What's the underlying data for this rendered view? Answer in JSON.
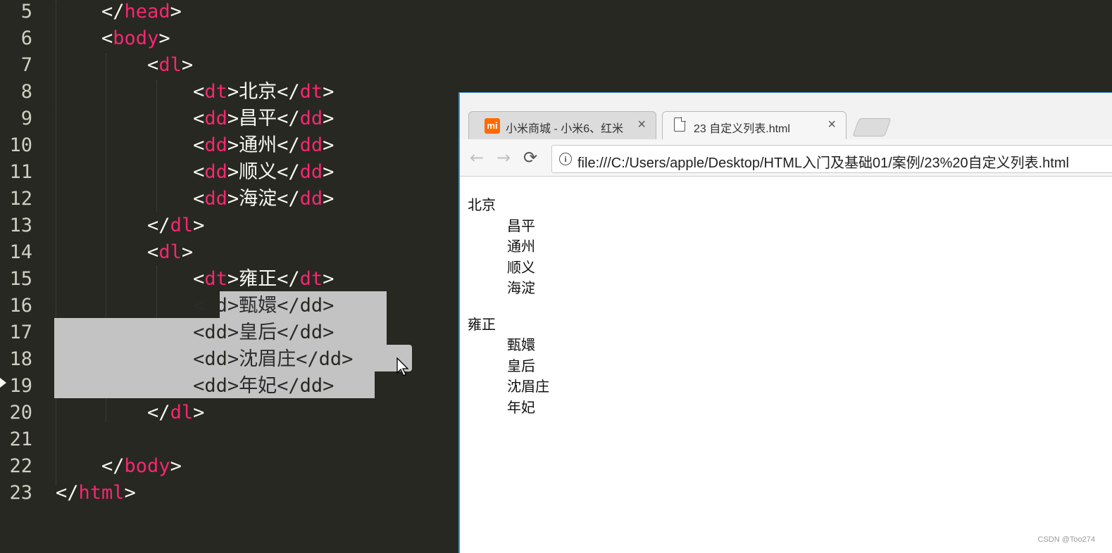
{
  "editor": {
    "lines": [
      {
        "num": "5",
        "indent": "    ",
        "open": "</",
        "tag": "head",
        "close": ">",
        "text": "",
        "etag": ""
      },
      {
        "num": "6",
        "indent": "    ",
        "open": "<",
        "tag": "body",
        "close": ">",
        "text": "",
        "etag": ""
      },
      {
        "num": "7",
        "indent": "        ",
        "open": "<",
        "tag": "dl",
        "close": ">",
        "text": "",
        "etag": ""
      },
      {
        "num": "8",
        "indent": "            ",
        "open": "<",
        "tag": "dt",
        "close": ">",
        "text": "北京",
        "etag": "dt"
      },
      {
        "num": "9",
        "indent": "            ",
        "open": "<",
        "tag": "dd",
        "close": ">",
        "text": "昌平",
        "etag": "dd"
      },
      {
        "num": "10",
        "indent": "            ",
        "open": "<",
        "tag": "dd",
        "close": ">",
        "text": "通州",
        "etag": "dd"
      },
      {
        "num": "11",
        "indent": "            ",
        "open": "<",
        "tag": "dd",
        "close": ">",
        "text": "顺义",
        "etag": "dd"
      },
      {
        "num": "12",
        "indent": "            ",
        "open": "<",
        "tag": "dd",
        "close": ">",
        "text": "海淀",
        "etag": "dd"
      },
      {
        "num": "13",
        "indent": "        ",
        "open": "</",
        "tag": "dl",
        "close": ">",
        "text": "",
        "etag": ""
      },
      {
        "num": "14",
        "indent": "        ",
        "open": "<",
        "tag": "dl",
        "close": ">",
        "text": "",
        "etag": ""
      },
      {
        "num": "15",
        "indent": "            ",
        "open": "<",
        "tag": "dt",
        "close": ">",
        "text": "雍正",
        "etag": "dt"
      },
      {
        "num": "16",
        "indent": "            ",
        "open": "<",
        "tag": "dd",
        "close": ">",
        "text": "甄嬛",
        "etag": "dd"
      },
      {
        "num": "17",
        "indent": "            ",
        "open": "<",
        "tag": "dd",
        "close": ">",
        "text": "皇后",
        "etag": "dd"
      },
      {
        "num": "18",
        "indent": "            ",
        "open": "<",
        "tag": "dd",
        "close": ">",
        "text": "沈眉庄",
        "etag": "dd"
      },
      {
        "num": "19",
        "indent": "            ",
        "open": "<",
        "tag": "dd",
        "close": ">",
        "text": "年妃",
        "etag": "dd"
      },
      {
        "num": "20",
        "indent": "        ",
        "open": "</",
        "tag": "dl",
        "close": ">",
        "text": "",
        "etag": ""
      },
      {
        "num": "21",
        "indent": "",
        "open": "",
        "tag": "",
        "close": "",
        "text": "",
        "etag": ""
      },
      {
        "num": "22",
        "indent": "    ",
        "open": "</",
        "tag": "body",
        "close": ">",
        "text": "",
        "etag": ""
      },
      {
        "num": "23",
        "indent": "",
        "open": "</",
        "tag": "html",
        "close": ">",
        "text": "",
        "etag": ""
      }
    ]
  },
  "browser": {
    "tabs": [
      {
        "title": "小米商城 - 小米6、红米",
        "close": "×",
        "icon": "mi"
      },
      {
        "title": "23 自定义列表.html",
        "close": "×"
      }
    ],
    "nav": {
      "back": "←",
      "forward": "→",
      "reload": "⟳"
    },
    "omnibox": {
      "info": "i",
      "url": "file:///C:/Users/apple/Desktop/HTML入门及基础01/案例/23%20自定义列表.html"
    },
    "content": {
      "lists": [
        {
          "dt": "北京",
          "dd": [
            "昌平",
            "通州",
            "顺义",
            "海淀"
          ]
        },
        {
          "dt": "雍正",
          "dd": [
            "甄嬛",
            "皇后",
            "沈眉庄",
            "年妃"
          ]
        }
      ]
    }
  },
  "watermark": "CSDN @Too274",
  "colors": {
    "editor_bg": "#272822",
    "tag": "#f92672",
    "text": "#f8f8f2",
    "selection": "#c3c3c3",
    "browser_border": "#3e8ed0"
  }
}
